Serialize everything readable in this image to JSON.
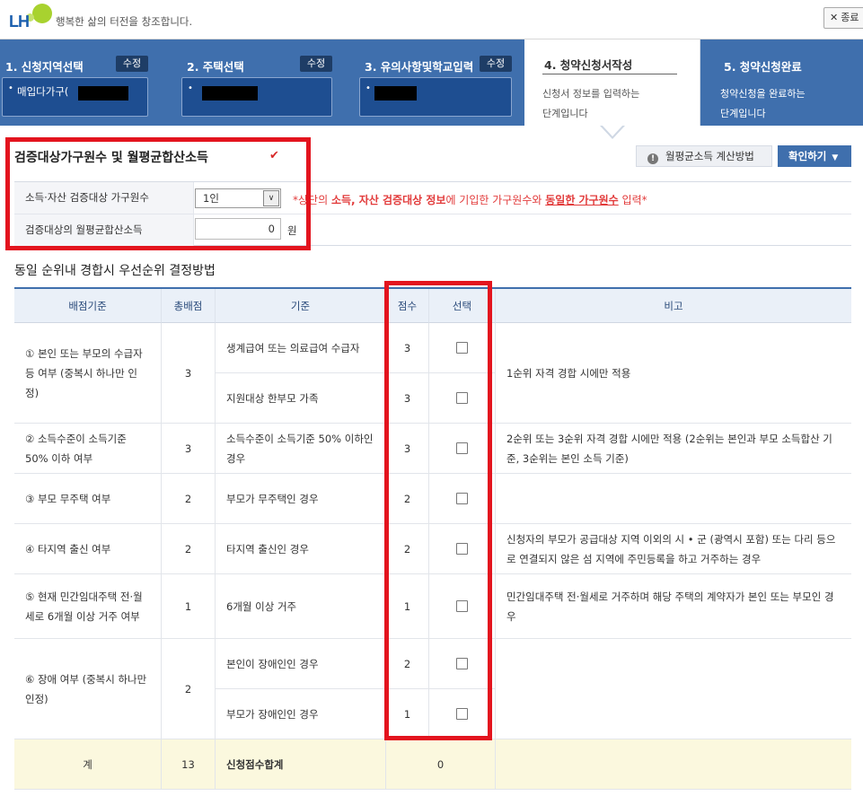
{
  "header": {
    "logo_text": "LH",
    "slogan": "행복한 삶의 터전을 창조합니다.",
    "close_label": "종료"
  },
  "steps": [
    {
      "title": "1. 신청지역선택",
      "edit": "수정",
      "value": "매입다가구("
    },
    {
      "title": "2. 주택선택",
      "edit": "수정",
      "value": ""
    },
    {
      "title": "3. 유의사항및학교입력",
      "edit": "수정",
      "value": ""
    },
    {
      "title": "4. 청약신청서작성",
      "desc1": "신청서 정보를 입력하는",
      "desc2": "단계입니다"
    },
    {
      "title": "5. 청약신청완료",
      "desc1": "청약신청을 완료하는",
      "desc2": "단계입니다"
    }
  ],
  "section1": {
    "title": "검증대상가구원수 및 월평균합산소득",
    "calc_button": "월평균소득 계산방법",
    "confirm_button": "확인하기",
    "row1_label": "소득·자산 검증대상 가구원수",
    "household_selected": "1인",
    "note_prefix": "*상단의 ",
    "note_bold": "소득, 자산 검증대상 정보",
    "note_mid": "에 기입한 가구원수와 ",
    "note_underline": "동일한 가구원수",
    "note_suffix": " 입력*",
    "row2_label": "검증대상의 월평균합산소득",
    "income_value": "0",
    "income_unit": "원"
  },
  "section2": {
    "title": "동일 순위내 경합시 우선순위 결정방법",
    "headers": [
      "배점기준",
      "총배점",
      "기준",
      "점수",
      "선택",
      "비고"
    ],
    "groups": [
      {
        "criterion": "① 본인 또는 부모의 수급자 등 여부 (중복시 하나만 인정)",
        "total": "3",
        "note": "1순위 자격 경합 시에만 적용",
        "rows": [
          {
            "basis": "생계급여 또는 의료급여 수급자",
            "score": "3"
          },
          {
            "basis": "지원대상 한부모 가족",
            "score": "3"
          }
        ]
      },
      {
        "criterion": "② 소득수준이 소득기준 50% 이하 여부",
        "total": "3",
        "note": "2순위 또는 3순위 자격 경합 시에만 적용 (2순위는 본인과 부모 소득합산 기준, 3순위는 본인 소득 기준)",
        "rows": [
          {
            "basis": "소득수준이 소득기준 50% 이하인 경우",
            "score": "3"
          }
        ]
      },
      {
        "criterion": "③ 부모 무주택 여부",
        "total": "2",
        "note": "",
        "rows": [
          {
            "basis": "부모가 무주택인 경우",
            "score": "2"
          }
        ]
      },
      {
        "criterion": "④ 타지역 출신 여부",
        "total": "2",
        "note": "신청자의 부모가 공급대상 지역 이외의 시 • 군 (광역시 포함) 또는 다리 등으로 연결되지 않은 섬 지역에 주민등록을 하고 거주하는 경우",
        "rows": [
          {
            "basis": "타지역 출신인 경우",
            "score": "2"
          }
        ]
      },
      {
        "criterion": "⑤ 현재 민간임대주택 전·월세로 6개월 이상 거주 여부",
        "total": "1",
        "note": "민간임대주택 전·월세로 거주하며 해당 주택의 계약자가 본인 또는 부모인 경우",
        "rows": [
          {
            "basis": "6개월 이상 거주",
            "score": "1"
          }
        ]
      },
      {
        "criterion": "⑥ 장애 여부 (중복시 하나만 인정)",
        "total": "2",
        "note": "",
        "rows": [
          {
            "basis": "본인이 장애인인 경우",
            "score": "2"
          },
          {
            "basis": "부모가 장애인인 경우",
            "score": "1"
          }
        ]
      }
    ],
    "total_label": "계",
    "total_points": "13",
    "sum_label": "신청점수합계",
    "sum_value": "0"
  },
  "colors": {
    "brand_blue": "#3f6fad",
    "highlight_red": "#e3141e",
    "total_row": "#fbf8de"
  }
}
